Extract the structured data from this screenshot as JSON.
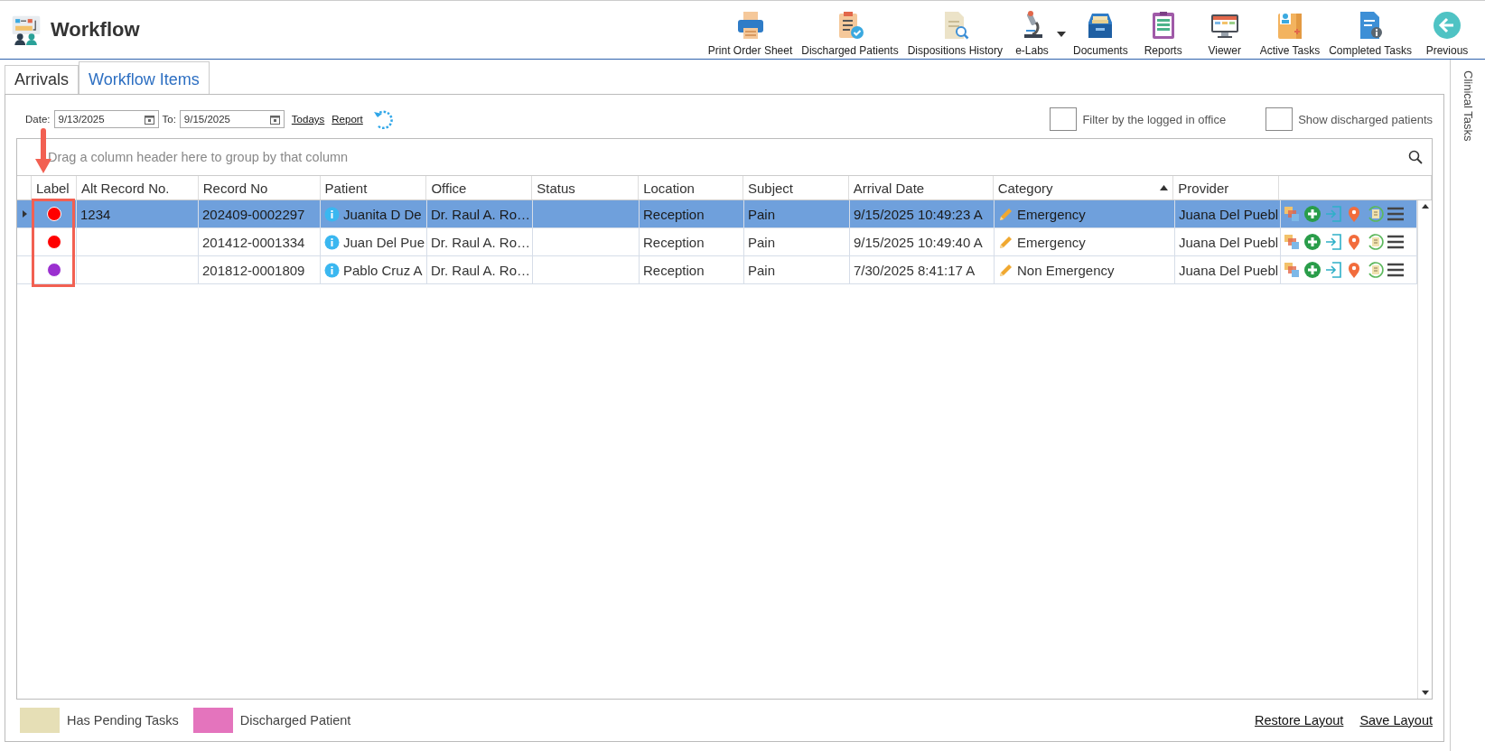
{
  "window": {
    "title": "Workflow"
  },
  "toolbar": [
    {
      "label": "Print Order Sheet",
      "kind": "printer",
      "dropdown": false
    },
    {
      "label": "Discharged Patients",
      "kind": "clipboard-check",
      "dropdown": false
    },
    {
      "label": "Dispositions History",
      "kind": "doc-search",
      "dropdown": false
    },
    {
      "label": "e-Labs",
      "kind": "microscope",
      "dropdown": true
    },
    {
      "label": "Documents",
      "kind": "drawer",
      "dropdown": false
    },
    {
      "label": "Reports",
      "kind": "clipboard",
      "dropdown": false
    },
    {
      "label": "Viewer",
      "kind": "monitor",
      "dropdown": false
    },
    {
      "label": "Active Tasks",
      "kind": "folder",
      "dropdown": false
    },
    {
      "label": "Completed Tasks",
      "kind": "doc-info",
      "dropdown": false
    },
    {
      "label": "Previous",
      "kind": "back",
      "dropdown": false
    }
  ],
  "tabs": [
    {
      "label": "Arrivals",
      "selected": false
    },
    {
      "label": "Workflow Items",
      "selected": true
    }
  ],
  "filters": {
    "from_label": "Date:",
    "from_value": "9/13/2025",
    "to_label": "To:",
    "to_value": "9/15/2025",
    "links": [
      "Todays",
      "Report"
    ],
    "checkboxes": [
      {
        "label": "Filter by the logged in office",
        "checked": false
      },
      {
        "label": "Show discharged patients",
        "checked": false
      }
    ]
  },
  "grid": {
    "group_hint": "Drag a column header here to group by that column",
    "columns": [
      {
        "label": "Label",
        "sorted": false
      },
      {
        "label": "Alt Record No.",
        "sorted": false
      },
      {
        "label": "Record No",
        "sorted": false
      },
      {
        "label": "Patient",
        "sorted": false
      },
      {
        "label": "Office",
        "sorted": false
      },
      {
        "label": "Status",
        "sorted": false
      },
      {
        "label": "Location",
        "sorted": false
      },
      {
        "label": "Subject",
        "sorted": false
      },
      {
        "label": "Arrival Date",
        "sorted": false
      },
      {
        "label": "Category",
        "sorted": true
      },
      {
        "label": "Provider",
        "sorted": false
      }
    ],
    "rows": [
      {
        "selected": true,
        "color": "#ff0000",
        "alt_record_no": "1234",
        "record_no": "202409-0002297",
        "patient": "Juanita D De",
        "office": "Dr. Raul A. Ro…",
        "location": "Reception",
        "subject": "Pain",
        "arrival_date": "9/15/2025 10:49:23 A",
        "category": "Emergency",
        "provider": "Juana Del Puebl"
      },
      {
        "selected": false,
        "color": "#ff0000",
        "record_no": "201412-0001334",
        "patient": "Juan Del Pue",
        "office": "Dr. Raul A. Ro…",
        "location": "Reception",
        "subject": "Pain",
        "arrival_date": "9/15/2025 10:49:40 A",
        "category": "Emergency",
        "provider": "Juana Del Puebl"
      },
      {
        "selected": false,
        "color": "#9b30d0",
        "record_no": "201812-0001809",
        "patient": "Pablo Cruz A",
        "office": "Dr. Raul A. Ro…",
        "location": "Reception",
        "subject": "Pain",
        "arrival_date": "7/30/2025 8:41:17 A",
        "category": "Non Emergency",
        "provider": "Juana Del Puebl"
      }
    ]
  },
  "callout": {
    "kind": "arrow-box"
  },
  "legend": [
    {
      "label": "Has Pending Tasks",
      "color": "#e6dfb6"
    },
    {
      "label": "Discharged Patient",
      "color": "#e474bd"
    }
  ],
  "layout_links": [
    "Restore Layout",
    "Save Layout"
  ],
  "side_panel": {
    "label": "Clinical Tasks"
  }
}
